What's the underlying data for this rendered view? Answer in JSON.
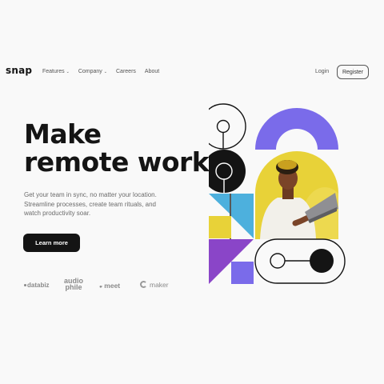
{
  "brand": {
    "logo_text": "snap"
  },
  "nav": {
    "items": [
      {
        "label": "Features",
        "has_dropdown": true
      },
      {
        "label": "Company",
        "has_dropdown": true
      },
      {
        "label": "Careers",
        "has_dropdown": false
      },
      {
        "label": "About",
        "has_dropdown": false
      }
    ],
    "dropdown_icon": "chevron-down-icon"
  },
  "auth": {
    "login_label": "Login",
    "register_label": "Register"
  },
  "hero": {
    "headline_line1": "Make",
    "headline_line2": "remote work",
    "subcopy": "Get your team in sync, no matter your location. Streamline processes, create team rituals, and watch productivity soar.",
    "cta_label": "Learn more"
  },
  "clients": [
    {
      "name": "databiz",
      "icon": "dot-icon"
    },
    {
      "name_line1": "audio",
      "name_line2": "phile"
    },
    {
      "name": "meet",
      "icon": "dots-icon"
    },
    {
      "name": "maker",
      "icon": "maker-swirl-icon"
    }
  ],
  "colors": {
    "background": "#f9f9f9",
    "text": "#141414",
    "muted": "#6b6b6b",
    "purple": "#7a6bea",
    "yellow": "#e8d238",
    "blue": "#4db0dd",
    "violet": "#8a45c8",
    "black": "#141414"
  }
}
